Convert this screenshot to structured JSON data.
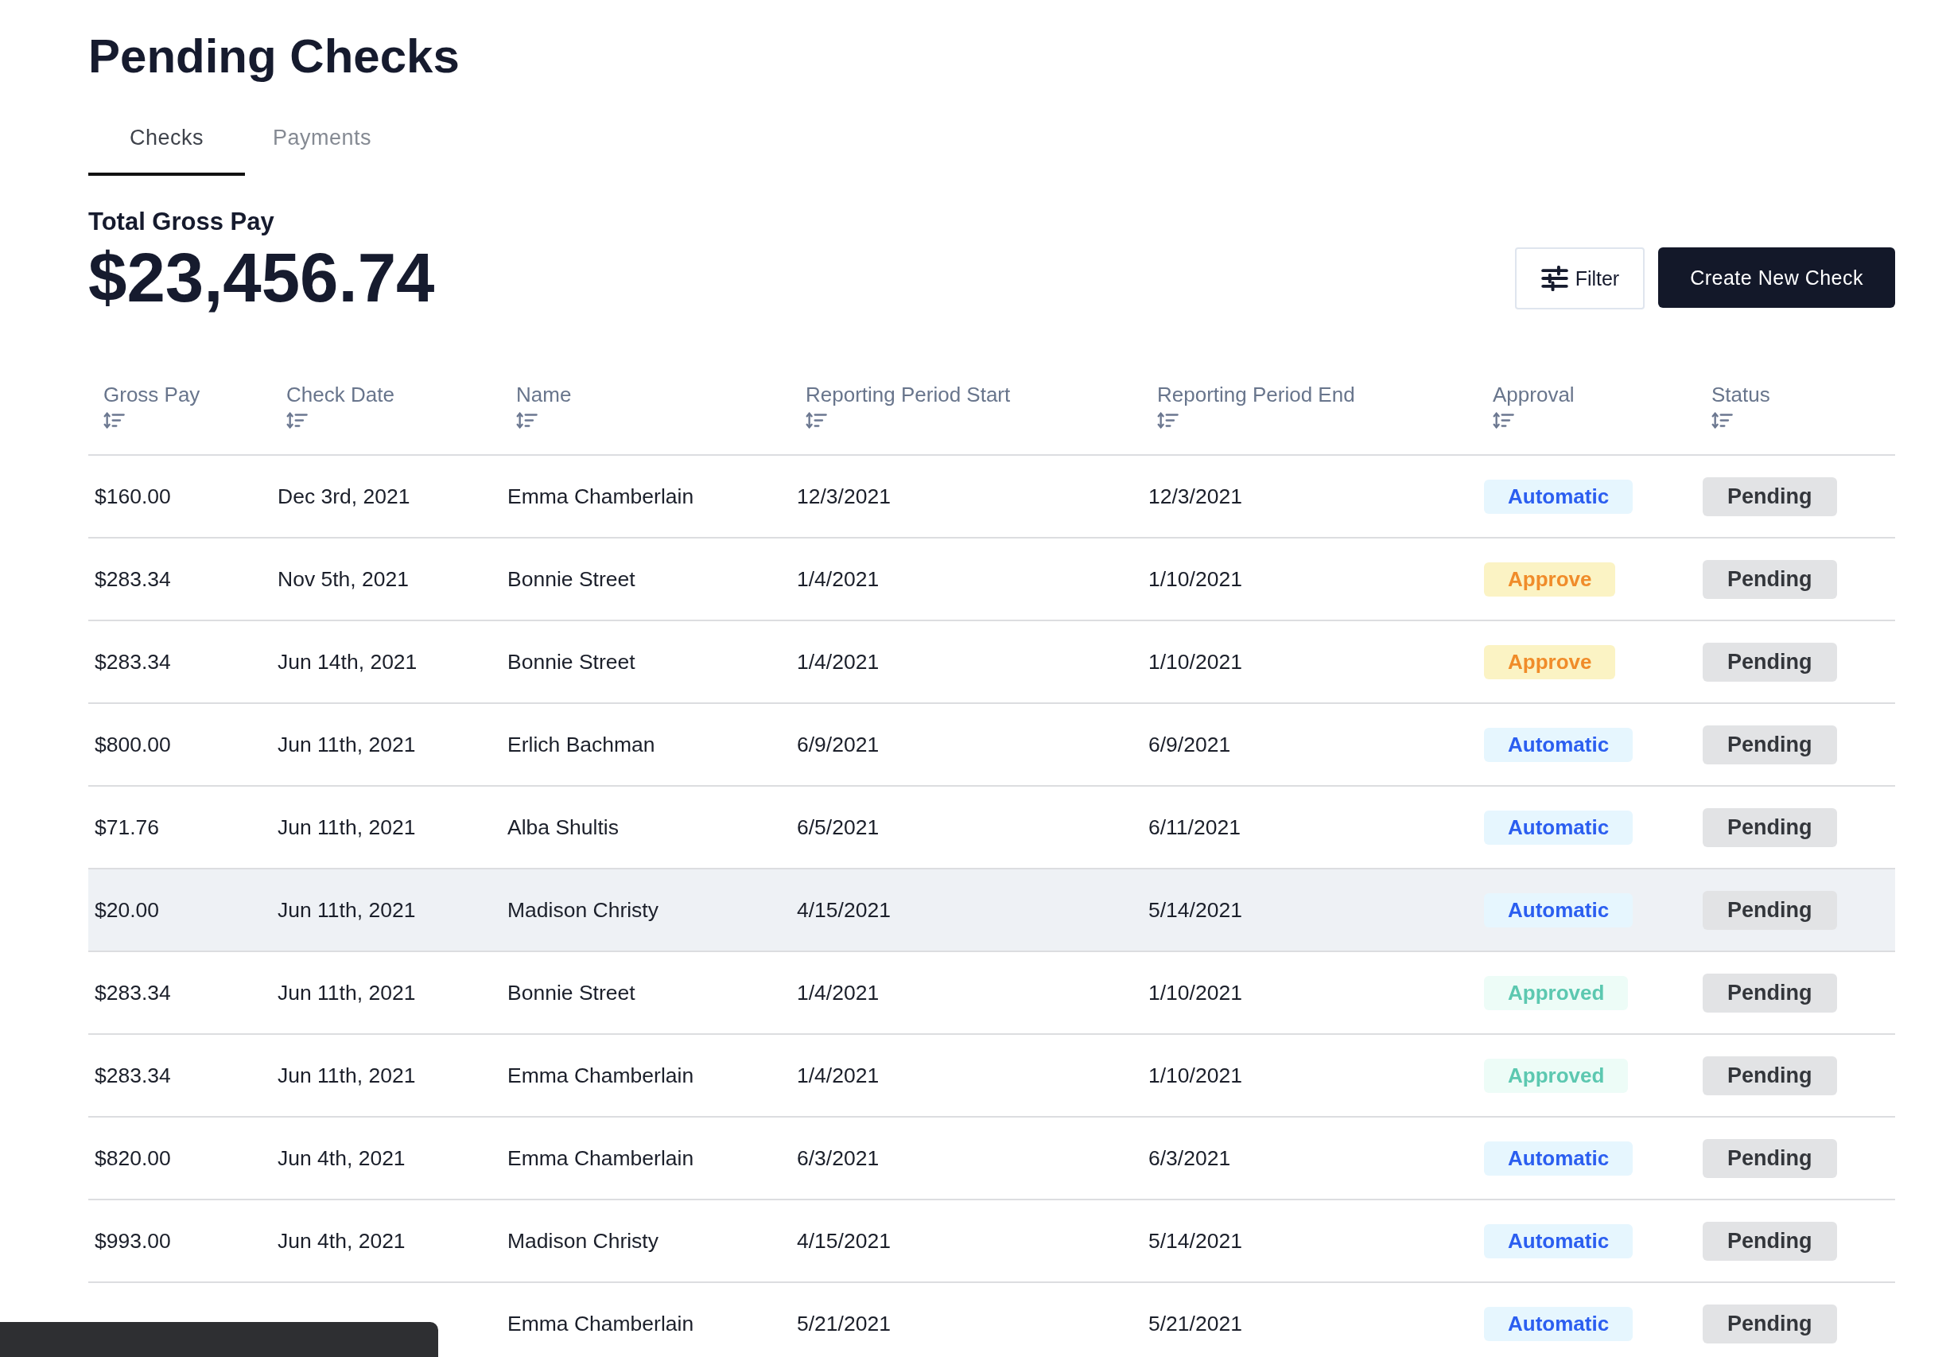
{
  "page": {
    "title": "Pending Checks"
  },
  "tabs": [
    {
      "label": "Checks",
      "selected": true
    },
    {
      "label": "Payments",
      "selected": false
    }
  ],
  "summary": {
    "label": "Total Gross Pay",
    "amount": "$23,456.74"
  },
  "actions": {
    "filter": "Filter",
    "create": "Create New Check"
  },
  "table": {
    "columns": [
      "Gross Pay",
      "Check Date",
      "Name",
      "Reporting Period Start",
      "Reporting Period End",
      "Approval",
      "Status"
    ],
    "rows": [
      {
        "gross_pay": "$160.00",
        "check_date": "Dec 3rd, 2021",
        "name": "Emma Chamberlain",
        "period_start": "12/3/2021",
        "period_end": "12/3/2021",
        "approval": {
          "label": "Automatic",
          "kind": "automatic"
        },
        "status": "Pending",
        "highlighted": false
      },
      {
        "gross_pay": "$283.34",
        "check_date": "Nov 5th, 2021",
        "name": "Bonnie Street",
        "period_start": "1/4/2021",
        "period_end": "1/10/2021",
        "approval": {
          "label": "Approve",
          "kind": "approve"
        },
        "status": "Pending",
        "highlighted": false
      },
      {
        "gross_pay": "$283.34",
        "check_date": "Jun 14th, 2021",
        "name": "Bonnie Street",
        "period_start": "1/4/2021",
        "period_end": "1/10/2021",
        "approval": {
          "label": "Approve",
          "kind": "approve"
        },
        "status": "Pending",
        "highlighted": false
      },
      {
        "gross_pay": "$800.00",
        "check_date": "Jun 11th, 2021",
        "name": "Erlich Bachman",
        "period_start": "6/9/2021",
        "period_end": "6/9/2021",
        "approval": {
          "label": "Automatic",
          "kind": "automatic"
        },
        "status": "Pending",
        "highlighted": false
      },
      {
        "gross_pay": "$71.76",
        "check_date": "Jun 11th, 2021",
        "name": "Alba Shultis",
        "period_start": "6/5/2021",
        "period_end": "6/11/2021",
        "approval": {
          "label": "Automatic",
          "kind": "automatic"
        },
        "status": "Pending",
        "highlighted": false
      },
      {
        "gross_pay": "$20.00",
        "check_date": "Jun 11th, 2021",
        "name": "Madison Christy",
        "period_start": "4/15/2021",
        "period_end": "5/14/2021",
        "approval": {
          "label": "Automatic",
          "kind": "automatic"
        },
        "status": "Pending",
        "highlighted": true
      },
      {
        "gross_pay": "$283.34",
        "check_date": "Jun 11th, 2021",
        "name": "Bonnie Street",
        "period_start": "1/4/2021",
        "period_end": "1/10/2021",
        "approval": {
          "label": "Approved",
          "kind": "approved"
        },
        "status": "Pending",
        "highlighted": false
      },
      {
        "gross_pay": "$283.34",
        "check_date": "Jun 11th, 2021",
        "name": "Emma Chamberlain",
        "period_start": "1/4/2021",
        "period_end": "1/10/2021",
        "approval": {
          "label": "Approved",
          "kind": "approved"
        },
        "status": "Pending",
        "highlighted": false
      },
      {
        "gross_pay": "$820.00",
        "check_date": "Jun 4th, 2021",
        "name": "Emma Chamberlain",
        "period_start": "6/3/2021",
        "period_end": "6/3/2021",
        "approval": {
          "label": "Automatic",
          "kind": "automatic"
        },
        "status": "Pending",
        "highlighted": false
      },
      {
        "gross_pay": "$993.00",
        "check_date": "Jun 4th, 2021",
        "name": "Madison Christy",
        "period_start": "4/15/2021",
        "period_end": "5/14/2021",
        "approval": {
          "label": "Automatic",
          "kind": "automatic"
        },
        "status": "Pending",
        "highlighted": false
      },
      {
        "name": "Emma Chamberlain",
        "period_start": "5/21/2021",
        "period_end": "5/21/2021",
        "approval": {
          "label": "Automatic",
          "kind": "automatic"
        },
        "status": "Pending",
        "highlighted": false
      }
    ]
  }
}
